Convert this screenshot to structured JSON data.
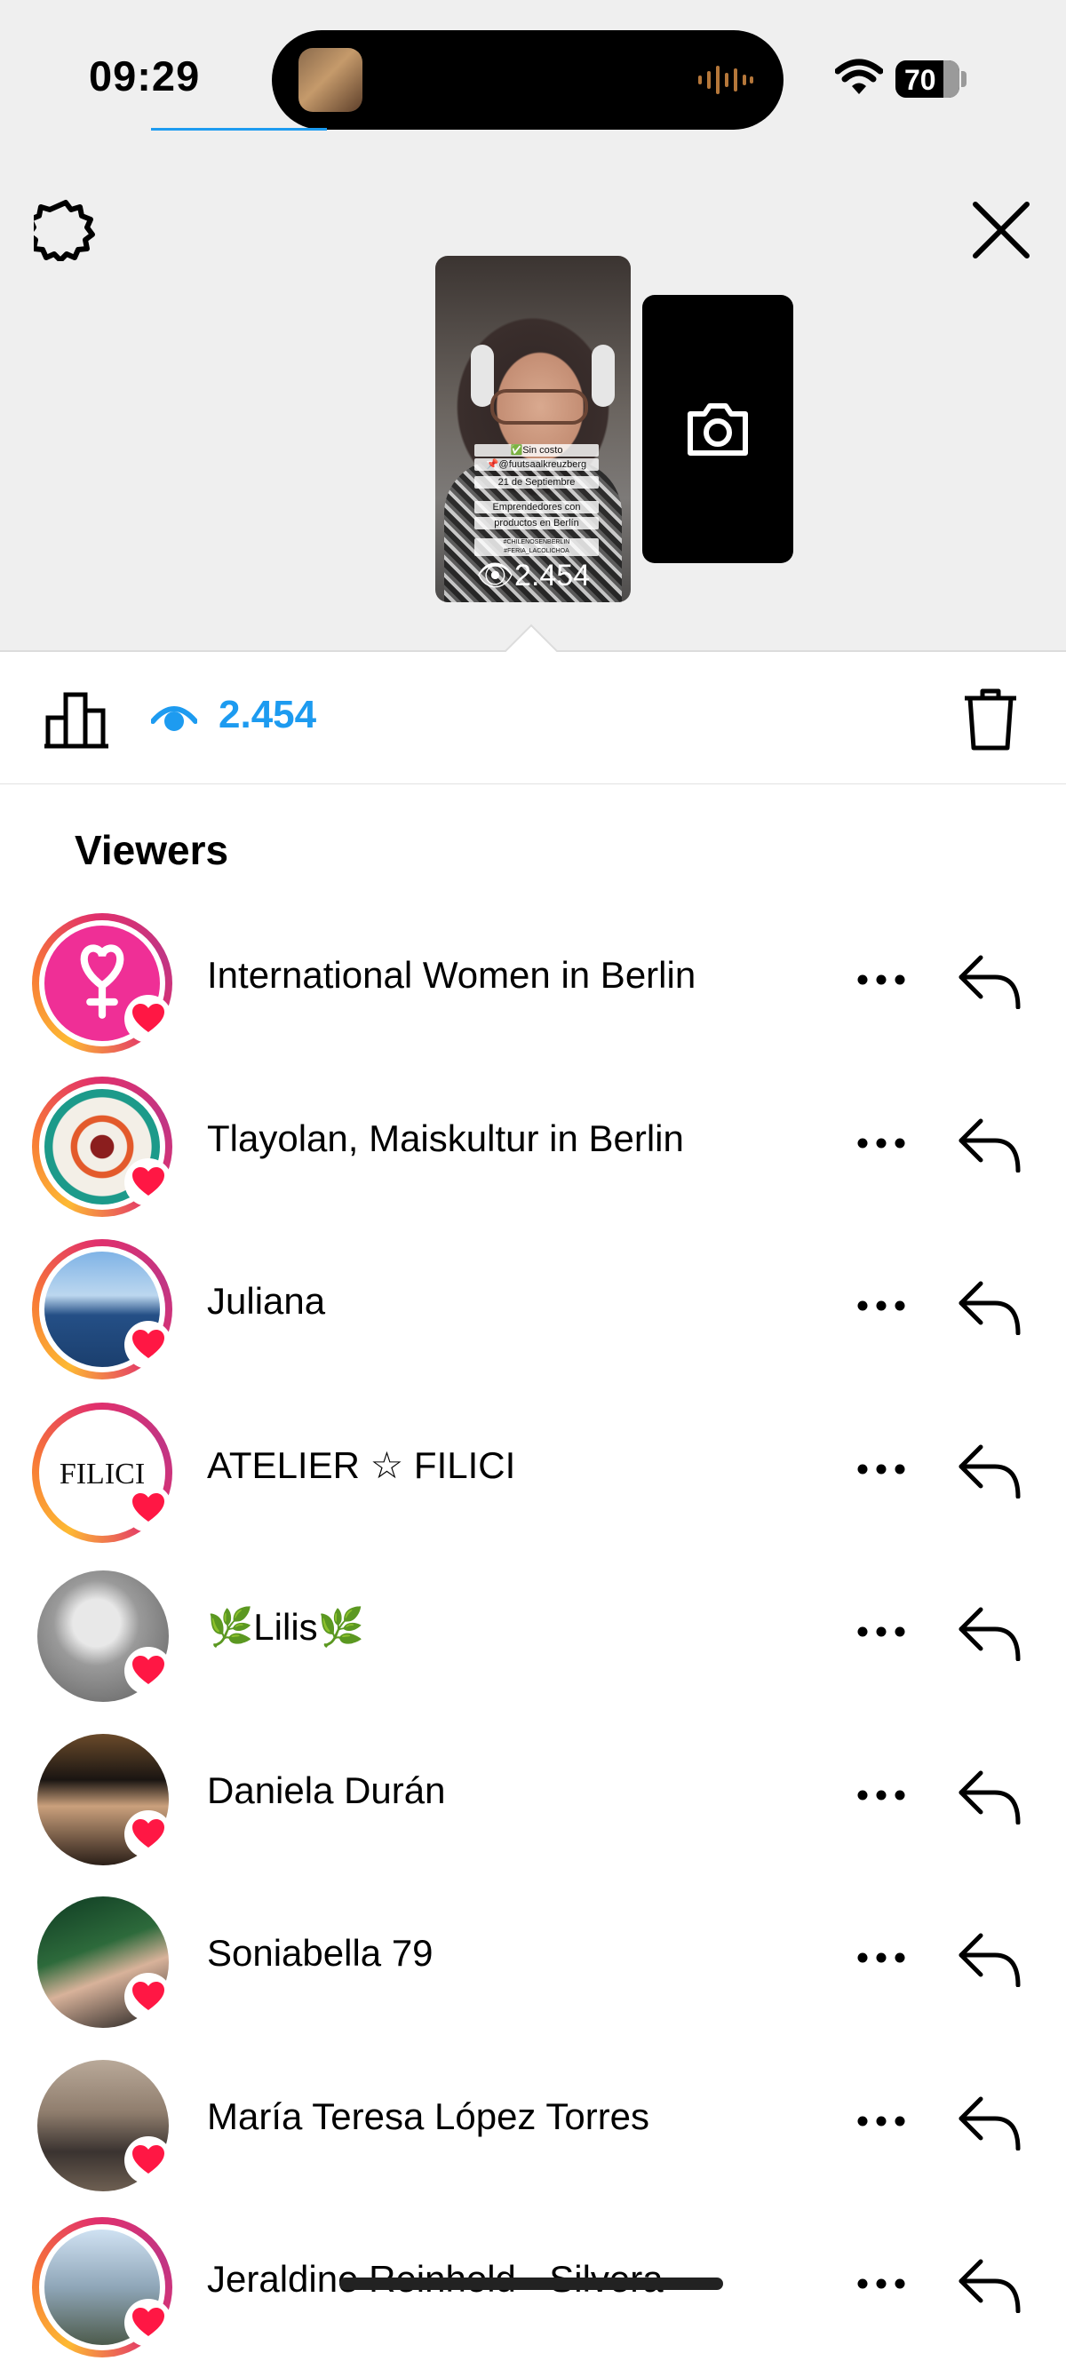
{
  "status_bar": {
    "time": "09:29",
    "battery": "70",
    "wifi_icon": "wifi-icon",
    "island_icons": [
      "media-thumbnail-icon",
      "audio-wave-icon"
    ]
  },
  "header": {
    "settings_icon": "gear-icon",
    "close_icon": "close-icon"
  },
  "story": {
    "caption_lines": [
      "✅Sin costo",
      "📌@fuutsaalkreuzberg",
      "21 de Septiembre",
      "Emprendedores con",
      "productos en Berlín",
      "#CHILENOSENBERLIN  #FERIA_LACOLICHOA"
    ],
    "view_count": "2.454",
    "camera_icon": "camera-icon"
  },
  "toolbar": {
    "insights_icon": "bar-chart-icon",
    "views_label": "2.454",
    "delete_icon": "trash-icon"
  },
  "viewers": {
    "title": "Viewers",
    "items": [
      {
        "name": "International Women in Berlin",
        "ring": true
      },
      {
        "name": "Tlayolan, Maiskultur in Berlin",
        "ring": true
      },
      {
        "name": "Juliana",
        "ring": true
      },
      {
        "name": "ATELIER ☆ FILICI",
        "ring": true
      },
      {
        "name": "🌿Lilis🌿",
        "ring": false
      },
      {
        "name": "Daniela Durán",
        "ring": false
      },
      {
        "name": "Soniabella 79",
        "ring": false
      },
      {
        "name": "María Teresa López Torres",
        "ring": false
      },
      {
        "name": "Jeraldine Reinhold - Silvera",
        "ring": true
      }
    ]
  },
  "colors": {
    "accent_blue": "#1d9bf0",
    "heart_red": "#ff1744",
    "top_bg": "#efefef"
  }
}
